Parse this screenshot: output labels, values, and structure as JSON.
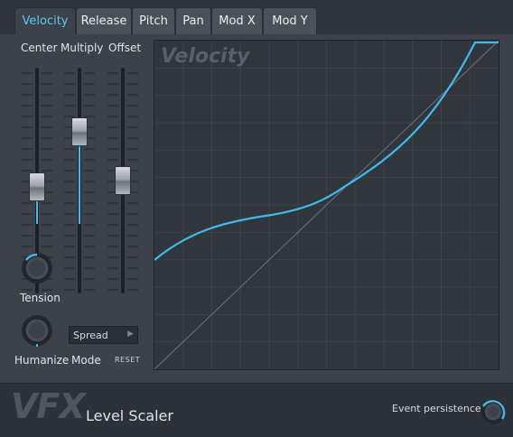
{
  "tabs": [
    {
      "label": "Velocity",
      "active": true
    },
    {
      "label": "Release",
      "active": false
    },
    {
      "label": "Pitch",
      "active": false
    },
    {
      "label": "Pan",
      "active": false
    },
    {
      "label": "Mod X",
      "active": false
    },
    {
      "label": "Mod Y",
      "active": false
    }
  ],
  "controls": {
    "center_label": "Center",
    "multiply_label": "Multiply",
    "offset_label": "Offset",
    "center_level": 0.47,
    "multiply_level": 0.75,
    "offset_level": 0.5,
    "tension_label": "Tension",
    "humanize_label": "Humanize",
    "mode_label": "Mode",
    "mode_value": "Spread",
    "reset_label": "RESET"
  },
  "graph": {
    "title": "Velocity"
  },
  "footer": {
    "brand": "VFX",
    "subtitle": "Level Scaler",
    "event_persistence_label": "Event persistence"
  },
  "colors": {
    "accent": "#44b8ec",
    "active_tab_text": "#5fc8f0",
    "background": "#3b4249",
    "graph_bg": "#2f363c"
  }
}
